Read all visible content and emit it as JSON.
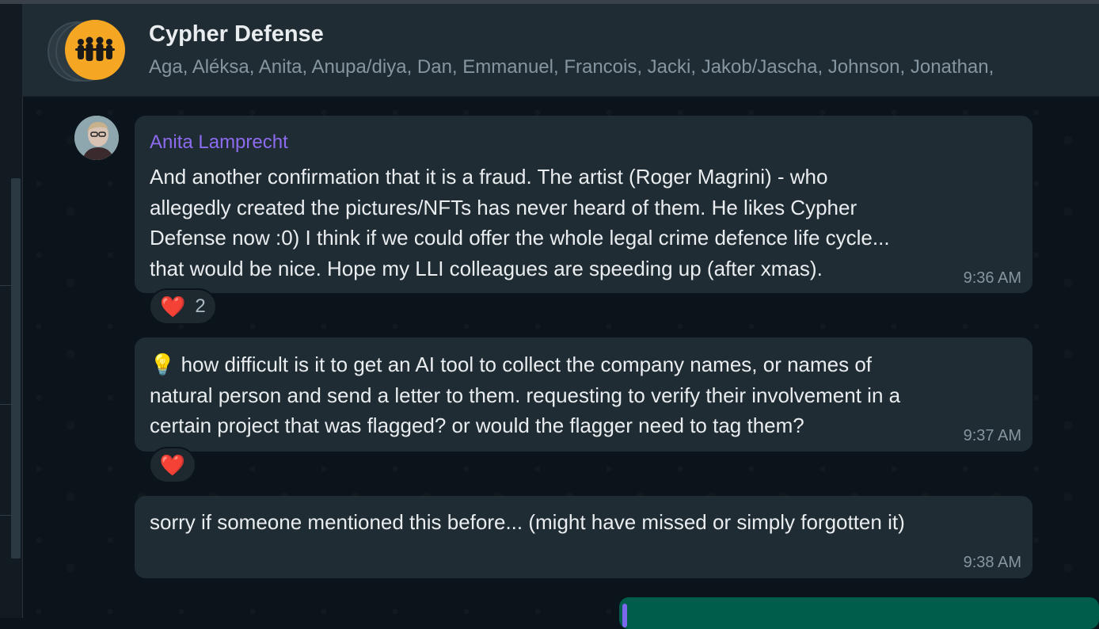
{
  "header": {
    "title": "Cypher Defense",
    "members": "Aga, Aléksa, Anita, Anupa/diya, Dan, Emmanuel, Francois, Jacki, Jakob/Jascha, Johnson, Jonathan,"
  },
  "messages": [
    {
      "sender": "Anita Lamprecht",
      "text": "And another confirmation that it is a fraud. The artist (Roger Magrini) - who\nallegedly created the pictures/NFTs has never heard of them. He likes Cypher\nDefense now :0) I think if we could offer the whole legal crime defence life cycle...\nthat would be nice. Hope my LLI colleagues are speeding up (after xmas).",
      "time": "9:36 AM",
      "reaction": {
        "emoji": "❤️",
        "count": "2"
      }
    },
    {
      "emoji_prefix": "💡",
      "text": " how difficult is it to get an AI tool to collect the company names, or names of\nnatural person and send a letter to them. requesting to verify their involvement in a\ncertain project that was flagged? or would the flagger need to tag them?",
      "time": "9:37 AM",
      "reaction": {
        "emoji": "❤️"
      }
    },
    {
      "text": "sorry if someone mentioned this before... (might have missed or simply forgotten it)",
      "time": "9:38 AM"
    }
  ],
  "colors": {
    "header_bg": "#202c33",
    "bubble_bg": "#202c33",
    "sender_name": "#8d6bf0",
    "group_avatar": "#f5a623"
  }
}
